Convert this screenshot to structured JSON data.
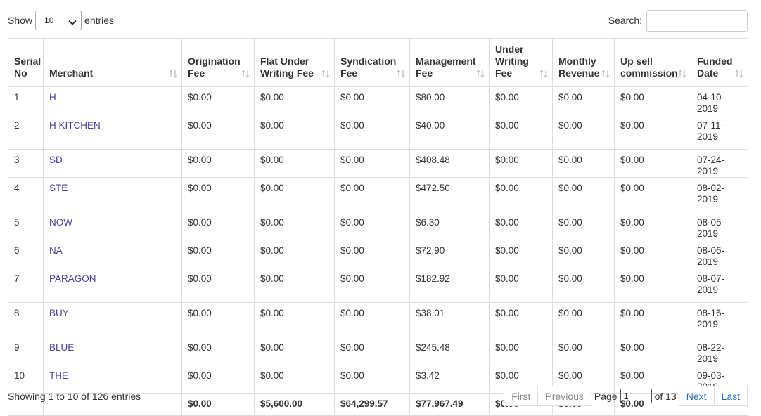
{
  "length_menu": {
    "show_label": "Show",
    "selected": "10",
    "entries_label": "entries"
  },
  "search": {
    "label": "Search:",
    "value": ""
  },
  "columns": [
    {
      "l1": "Serial",
      "l2": "No",
      "sortable": false
    },
    {
      "l1": "",
      "l2": "Merchant",
      "sortable": true
    },
    {
      "l1": "Origination",
      "l2": "Fee",
      "sortable": true
    },
    {
      "l1": "Flat Under",
      "l2": "Writing Fee",
      "sortable": true
    },
    {
      "l1": "Syndication",
      "l2": "Fee",
      "sortable": true
    },
    {
      "l1": "Management",
      "l2": "Fee",
      "sortable": true
    },
    {
      "l0": "Under",
      "l1": "Writing",
      "l2": "Fee",
      "sortable": true
    },
    {
      "l1": "Monthly",
      "l2": "Revenue",
      "sortable": true
    },
    {
      "l1": "Up sell",
      "l2": "commission",
      "sortable": true
    },
    {
      "l1": "Funded",
      "l2": "Date",
      "sortable": true
    }
  ],
  "rows": [
    {
      "serial": "1",
      "merchant": "H",
      "origination": "$0.00",
      "flat_under": "$0.00",
      "syndication": "$0.00",
      "management": "$80.00",
      "under_writing": "$0.00",
      "monthly": "$0.00",
      "upsell": "$0.00",
      "funded": "04-10-2019"
    },
    {
      "serial": "2",
      "merchant": "H KITCHEN",
      "origination": "$0.00",
      "flat_under": "$0.00",
      "syndication": "$0.00",
      "management": "$40.00",
      "under_writing": "$0.00",
      "monthly": "$0.00",
      "upsell": "$0.00",
      "funded": "07-11-2019"
    },
    {
      "serial": "3",
      "merchant": "SD",
      "origination": "$0.00",
      "flat_under": "$0.00",
      "syndication": "$0.00",
      "management": "$408.48",
      "under_writing": "$0.00",
      "monthly": "$0.00",
      "upsell": "$0.00",
      "funded": "07-24-2019"
    },
    {
      "serial": "4",
      "merchant": "STE",
      "origination": "$0.00",
      "flat_under": "$0.00",
      "syndication": "$0.00",
      "management": "$472.50",
      "under_writing": "$0.00",
      "monthly": "$0.00",
      "upsell": "$0.00",
      "funded": "08-02-2019"
    },
    {
      "serial": "5",
      "merchant": "NOW",
      "origination": "$0.00",
      "flat_under": "$0.00",
      "syndication": "$0.00",
      "management": "$6.30",
      "under_writing": "$0.00",
      "monthly": "$0.00",
      "upsell": "$0.00",
      "funded": "08-05-2019"
    },
    {
      "serial": "6",
      "merchant": "NA",
      "origination": "$0.00",
      "flat_under": "$0.00",
      "syndication": "$0.00",
      "management": "$72.90",
      "under_writing": "$0.00",
      "monthly": "$0.00",
      "upsell": "$0.00",
      "funded": "08-06-2019"
    },
    {
      "serial": "7",
      "merchant": "PARAGON",
      "origination": "$0.00",
      "flat_under": "$0.00",
      "syndication": "$0.00",
      "management": "$182.92",
      "under_writing": "$0.00",
      "monthly": "$0.00",
      "upsell": "$0.00",
      "funded": "08-07-2019"
    },
    {
      "serial": "8",
      "merchant": "BUY",
      "origination": "$0.00",
      "flat_under": "$0.00",
      "syndication": "$0.00",
      "management": "$38.01",
      "under_writing": "$0.00",
      "monthly": "$0.00",
      "upsell": "$0.00",
      "funded": "08-16-2019"
    },
    {
      "serial": "9",
      "merchant": "BLUE",
      "origination": "$0.00",
      "flat_under": "$0.00",
      "syndication": "$0.00",
      "management": "$245.48",
      "under_writing": "$0.00",
      "monthly": "$0.00",
      "upsell": "$0.00",
      "funded": "08-22-2019"
    },
    {
      "serial": "10",
      "merchant": "THE",
      "origination": "$0.00",
      "flat_under": "$0.00",
      "syndication": "$0.00",
      "management": "$3.42",
      "under_writing": "$0.00",
      "monthly": "$0.00",
      "upsell": "$0.00",
      "funded": "09-03-2019"
    }
  ],
  "totals": {
    "serial": "",
    "merchant": "",
    "origination": "$0.00",
    "flat_under": "$5,600.00",
    "syndication": "$64,299.57",
    "management": "$77,967.49",
    "under_writing": "$0.00",
    "monthly": "$0.00",
    "upsell": "$0.00",
    "funded": ""
  },
  "info": "Showing 1 to 10 of 126 entries",
  "pagination": {
    "first": "First",
    "previous": "Previous",
    "page_label": "Page",
    "page_value": "1",
    "of_label": "of 13",
    "next": "Next",
    "last": "Last"
  },
  "colors": {
    "link": "#4a3fa0",
    "pager_active": "#2c6db4",
    "border": "#dddddd"
  },
  "icons": {
    "sort": "sort-arrows-icon",
    "dropdown": "chevron-down-icon"
  }
}
